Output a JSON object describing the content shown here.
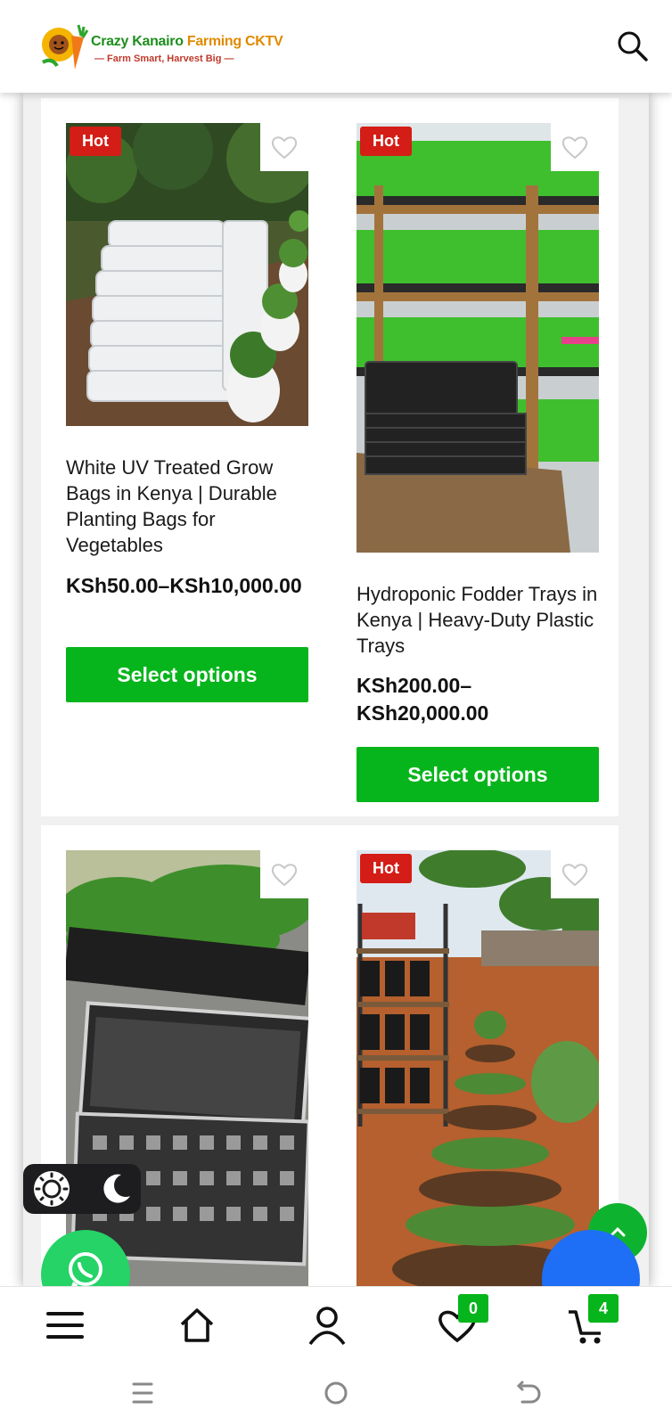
{
  "header": {
    "logo_title_part1": "Crazy Kanairo ",
    "logo_title_part2": "Farming CKTV",
    "logo_tagline": "— Farm Smart, Harvest Big —",
    "search_icon": "search-icon"
  },
  "products": [
    {
      "badge": "Hot",
      "title": "White UV Treated Grow Bags in Kenya | Durable Planting Bags for Vegetables",
      "price": "KSh50.00–KSh10,000.00",
      "button": "Select options"
    },
    {
      "badge": "Hot",
      "title": "Hydroponic Fodder Trays in Kenya | Heavy-Duty Plastic Trays",
      "price": "KSh200.00–KSh20,000.00",
      "button": "Select options"
    },
    {
      "badge": "",
      "title": "",
      "price": "",
      "button": ""
    },
    {
      "badge": "Hot",
      "title": "",
      "price": "",
      "button": ""
    }
  ],
  "bottom_nav": {
    "items": [
      "menu-icon",
      "home-icon",
      "account-icon",
      "wishlist-icon",
      "cart-icon"
    ],
    "wishlist_count": "0",
    "cart_count": "4"
  },
  "colors": {
    "accent_green": "#06b51b",
    "hot_red": "#d31d16",
    "whatsapp_green": "#25d366",
    "chat_blue": "#1e6ff5"
  }
}
